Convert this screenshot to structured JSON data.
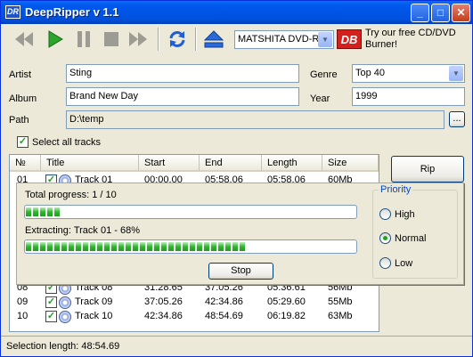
{
  "window": {
    "title": "DeepRipper v 1.1",
    "app_icon_text": "DR"
  },
  "toolbar": {
    "drive_selected": "MATSHITA DVD-R",
    "promo_logo": "DB",
    "promo_text": "Try our free CD/DVD Burner!"
  },
  "form": {
    "artist_label": "Artist",
    "artist_value": "Sting",
    "album_label": "Album",
    "album_value": "Brand New Day",
    "path_label": "Path",
    "path_value": "D:\\temp",
    "browse_label": "...",
    "genre_label": "Genre",
    "genre_value": "Top 40",
    "year_label": "Year",
    "year_value": "1999",
    "select_all_label": "Select all tracks"
  },
  "list": {
    "columns": [
      "№",
      "Title",
      "Start",
      "End",
      "Length",
      "Size"
    ],
    "rows": [
      {
        "no": "01",
        "title": "Track 01",
        "start": "00:00.00",
        "end": "05:58.06",
        "length": "05:58.06",
        "size": "60Mb"
      },
      {
        "no": "08",
        "title": "Track 08",
        "start": "31:28.65",
        "end": "37:05.26",
        "length": "05:36.61",
        "size": "56Mb"
      },
      {
        "no": "09",
        "title": "Track 09",
        "start": "37:05.26",
        "end": "42:34.86",
        "length": "05:29.60",
        "size": "55Mb"
      },
      {
        "no": "10",
        "title": "Track 10",
        "start": "42:34.86",
        "end": "48:54.69",
        "length": "06:19.82",
        "size": "63Mb"
      }
    ]
  },
  "rip_button": "Rip",
  "progress_dialog": {
    "total_label": "Total progress: 1 / 10",
    "total_fraction": 0.1,
    "extract_label": "Extracting: Track 01 - 68%",
    "extract_fraction": 0.68,
    "stop_label": "Stop",
    "priority_title": "Priority",
    "priority_options": [
      "High",
      "Normal",
      "Low"
    ],
    "priority_selected": "Normal"
  },
  "status": {
    "text": "Selection length:  48:54.69"
  }
}
